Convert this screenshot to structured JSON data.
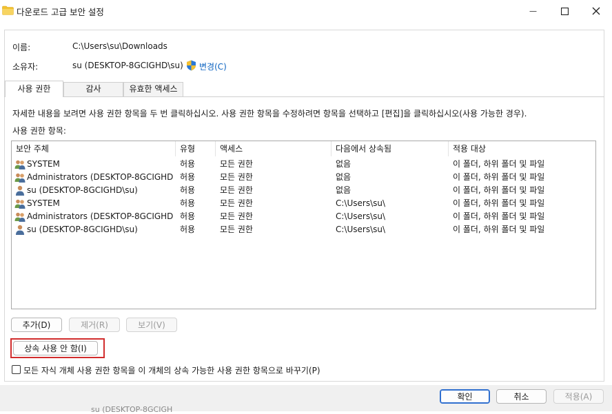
{
  "window": {
    "title": "다운로드 고급 보안 설정",
    "folder_icon_color": "#f2c230"
  },
  "fields": {
    "name_label": "이름:",
    "name_value": "C:\\Users\\su\\Downloads",
    "owner_label": "소유자:",
    "owner_value": "su (DESKTOP-8GCIGHD\\su)",
    "change_link": "변경(C)"
  },
  "tabs": [
    {
      "label": "사용 권한",
      "active": true
    },
    {
      "label": "감사",
      "active": false
    },
    {
      "label": "유효한 액세스",
      "active": false
    }
  ],
  "info_text": "자세한 내용을 보려면 사용 권한 항목을 두 번 클릭하십시오. 사용 권한 항목을 수정하려면 항목을 선택하고 [편집]을 클릭하십시오(사용 가능한 경우).",
  "entries_label": "사용 권한 항목:",
  "columns": [
    "보안 주체",
    "유형",
    "액세스",
    "다음에서 상속됨",
    "적용 대상"
  ],
  "rows": [
    {
      "icon": "group-users-icon",
      "principal": "SYSTEM",
      "type": "허용",
      "access": "모든 권한",
      "inherited": "없음",
      "applies": "이 폴더, 하위 폴더 및 파일"
    },
    {
      "icon": "group-users-icon",
      "principal": "Administrators (DESKTOP-8GCIGHD\\...",
      "type": "허용",
      "access": "모든 권한",
      "inherited": "없음",
      "applies": "이 폴더, 하위 폴더 및 파일"
    },
    {
      "icon": "user-icon",
      "principal": "su (DESKTOP-8GCIGHD\\su)",
      "type": "허용",
      "access": "모든 권한",
      "inherited": "없음",
      "applies": "이 폴더, 하위 폴더 및 파일"
    },
    {
      "icon": "group-users-icon",
      "principal": "SYSTEM",
      "type": "허용",
      "access": "모든 권한",
      "inherited": "C:\\Users\\su\\",
      "applies": "이 폴더, 하위 폴더 및 파일"
    },
    {
      "icon": "group-users-icon",
      "principal": "Administrators (DESKTOP-8GCIGHD\\...",
      "type": "허용",
      "access": "모든 권한",
      "inherited": "C:\\Users\\su\\",
      "applies": "이 폴더, 하위 폴더 및 파일"
    },
    {
      "icon": "user-icon",
      "principal": "su (DESKTOP-8GCIGHD\\su)",
      "type": "허용",
      "access": "모든 권한",
      "inherited": "C:\\Users\\su\\",
      "applies": "이 폴더, 하위 폴더 및 파일"
    }
  ],
  "buttons": {
    "add": "추가(D)",
    "remove": "제거(R)",
    "view": "보기(V)",
    "disable_inheritance": "상속 사용 안 함(I)",
    "ok": "확인",
    "cancel": "취소",
    "apply": "적용(A)"
  },
  "checkbox": {
    "label": "모든 자식 개체 사용 권한 항목을 이 개체의 상속 가능한 사용 권한 항목으로 바꾸기(P)",
    "checked": false
  },
  "background_window_text": "su (DESKTOP-8GCIGH",
  "colors": {
    "link": "#0a62c0",
    "highlight_border": "#d12c2c",
    "default_button_border": "#2f6fcf"
  }
}
